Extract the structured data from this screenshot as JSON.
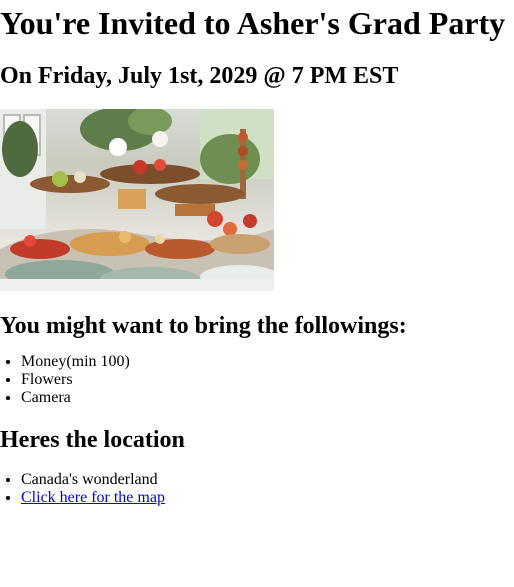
{
  "title": "You're Invited to Asher's Grad Party",
  "date_line": "On Friday, July 1st, 2029 @ 7 PM EST",
  "photo": {
    "alt": "Party food table"
  },
  "bring": {
    "heading": "You might want to bring the followings:",
    "items": [
      "Money(min 100)",
      "Flowers",
      "Camera"
    ]
  },
  "location": {
    "heading": "Heres the location",
    "place": "Canada's wonderland",
    "map_link": "Click here for the map"
  }
}
